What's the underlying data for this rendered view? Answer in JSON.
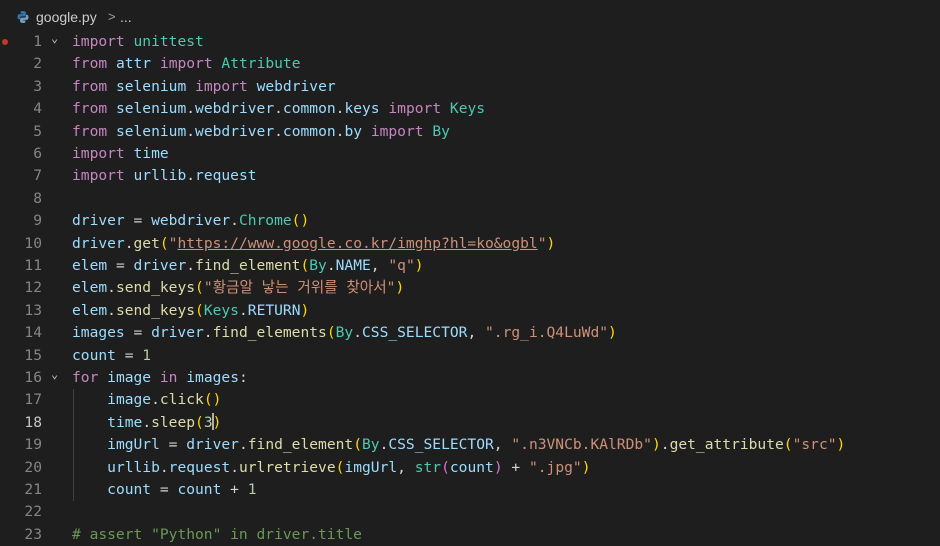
{
  "breadcrumb": {
    "filename": "google.py",
    "separator": ">",
    "ellipsis": "..."
  },
  "editor": {
    "active_line": 18,
    "lines": [
      {
        "n": "1",
        "fold": "v",
        "t": [
          [
            "import",
            "kw"
          ],
          [
            " ",
            ""
          ],
          [
            "unittest",
            "cls"
          ]
        ]
      },
      {
        "n": "2",
        "t": [
          [
            "from",
            "kw"
          ],
          [
            " ",
            ""
          ],
          [
            "attr",
            "v"
          ],
          [
            " ",
            ""
          ],
          [
            "import",
            "kw"
          ],
          [
            " ",
            ""
          ],
          [
            "Attribute",
            "cls"
          ]
        ]
      },
      {
        "n": "3",
        "t": [
          [
            "from",
            "kw"
          ],
          [
            " ",
            ""
          ],
          [
            "selenium",
            "v"
          ],
          [
            " ",
            ""
          ],
          [
            "import",
            "kw"
          ],
          [
            " ",
            ""
          ],
          [
            "webdriver",
            "v"
          ]
        ]
      },
      {
        "n": "4",
        "t": [
          [
            "from",
            "kw"
          ],
          [
            " ",
            ""
          ],
          [
            "selenium",
            "v"
          ],
          [
            ".",
            "p"
          ],
          [
            "webdriver",
            "v"
          ],
          [
            ".",
            "p"
          ],
          [
            "common",
            "v"
          ],
          [
            ".",
            "p"
          ],
          [
            "keys",
            "v"
          ],
          [
            " ",
            ""
          ],
          [
            "import",
            "kw"
          ],
          [
            " ",
            ""
          ],
          [
            "Keys",
            "cls"
          ]
        ]
      },
      {
        "n": "5",
        "t": [
          [
            "from",
            "kw"
          ],
          [
            " ",
            ""
          ],
          [
            "selenium",
            "v"
          ],
          [
            ".",
            "p"
          ],
          [
            "webdriver",
            "v"
          ],
          [
            ".",
            "p"
          ],
          [
            "common",
            "v"
          ],
          [
            ".",
            "p"
          ],
          [
            "by",
            "v"
          ],
          [
            " ",
            ""
          ],
          [
            "import",
            "kw"
          ],
          [
            " ",
            ""
          ],
          [
            "By",
            "cls"
          ]
        ]
      },
      {
        "n": "6",
        "t": [
          [
            "import",
            "kw"
          ],
          [
            " ",
            ""
          ],
          [
            "time",
            "v"
          ]
        ]
      },
      {
        "n": "7",
        "t": [
          [
            "import",
            "kw"
          ],
          [
            " ",
            ""
          ],
          [
            "urllib",
            "v"
          ],
          [
            ".",
            "p"
          ],
          [
            "request",
            "v"
          ]
        ]
      },
      {
        "n": "8",
        "t": []
      },
      {
        "n": "9",
        "t": [
          [
            "driver",
            "v"
          ],
          [
            " = ",
            "p"
          ],
          [
            "webdriver",
            "v"
          ],
          [
            ".",
            "p"
          ],
          [
            "Chrome",
            "cls"
          ],
          [
            "()",
            "b1"
          ]
        ]
      },
      {
        "n": "10",
        "t": [
          [
            "driver",
            "v"
          ],
          [
            ".",
            "p"
          ],
          [
            "get",
            "fn"
          ],
          [
            "(",
            "b1"
          ],
          [
            "\"",
            "s"
          ],
          [
            "https://www.google.co.kr/imghp?hl=ko&ogbl",
            "s u"
          ],
          [
            "\"",
            "s"
          ],
          [
            ")",
            "b1"
          ]
        ]
      },
      {
        "n": "11",
        "t": [
          [
            "elem",
            "v"
          ],
          [
            " = ",
            "p"
          ],
          [
            "driver",
            "v"
          ],
          [
            ".",
            "p"
          ],
          [
            "find_element",
            "fn"
          ],
          [
            "(",
            "b1"
          ],
          [
            "By",
            "cls"
          ],
          [
            ".",
            "p"
          ],
          [
            "NAME",
            "v"
          ],
          [
            ", ",
            "p"
          ],
          [
            "\"q\"",
            "s"
          ],
          [
            ")",
            "b1"
          ]
        ]
      },
      {
        "n": "12",
        "t": [
          [
            "elem",
            "v"
          ],
          [
            ".",
            "p"
          ],
          [
            "send_keys",
            "fn"
          ],
          [
            "(",
            "b1"
          ],
          [
            "\"황금알 낳는 거위를 찾아서\"",
            "s"
          ],
          [
            ")",
            "b1"
          ]
        ]
      },
      {
        "n": "13",
        "t": [
          [
            "elem",
            "v"
          ],
          [
            ".",
            "p"
          ],
          [
            "send_keys",
            "fn"
          ],
          [
            "(",
            "b1"
          ],
          [
            "Keys",
            "cls"
          ],
          [
            ".",
            "p"
          ],
          [
            "RETURN",
            "v"
          ],
          [
            ")",
            "b1"
          ]
        ]
      },
      {
        "n": "14",
        "t": [
          [
            "images",
            "v"
          ],
          [
            " = ",
            "p"
          ],
          [
            "driver",
            "v"
          ],
          [
            ".",
            "p"
          ],
          [
            "find_elements",
            "fn"
          ],
          [
            "(",
            "b1"
          ],
          [
            "By",
            "cls"
          ],
          [
            ".",
            "p"
          ],
          [
            "CSS_SELECTOR",
            "v"
          ],
          [
            ", ",
            "p"
          ],
          [
            "\".rg_i.Q4LuWd\"",
            "s"
          ],
          [
            ")",
            "b1"
          ]
        ]
      },
      {
        "n": "15",
        "t": [
          [
            "count",
            "v"
          ],
          [
            " = ",
            "p"
          ],
          [
            "1",
            "n"
          ]
        ]
      },
      {
        "n": "16",
        "fold": "v",
        "t": [
          [
            "for",
            "kw"
          ],
          [
            " ",
            ""
          ],
          [
            "image",
            "v"
          ],
          [
            " ",
            ""
          ],
          [
            "in",
            "kw"
          ],
          [
            " ",
            ""
          ],
          [
            "images",
            "v"
          ],
          [
            ":",
            "p"
          ]
        ]
      },
      {
        "n": "17",
        "t": [
          [
            "    ",
            ""
          ],
          [
            "image",
            "v"
          ],
          [
            ".",
            "p"
          ],
          [
            "click",
            "fn"
          ],
          [
            "()",
            "b1"
          ]
        ]
      },
      {
        "n": "18",
        "t": [
          [
            "    ",
            ""
          ],
          [
            "time",
            "v"
          ],
          [
            ".",
            "p"
          ],
          [
            "sleep",
            "fn"
          ],
          [
            "(",
            "b1"
          ],
          [
            "3",
            "n"
          ],
          [
            "|",
            "cursor"
          ],
          [
            ")",
            "b1"
          ]
        ]
      },
      {
        "n": "19",
        "t": [
          [
            "    ",
            ""
          ],
          [
            "imgUrl",
            "v"
          ],
          [
            " = ",
            "p"
          ],
          [
            "driver",
            "v"
          ],
          [
            ".",
            "p"
          ],
          [
            "find_element",
            "fn"
          ],
          [
            "(",
            "b1"
          ],
          [
            "By",
            "cls"
          ],
          [
            ".",
            "p"
          ],
          [
            "CSS_SELECTOR",
            "v"
          ],
          [
            ", ",
            "p"
          ],
          [
            "\".n3VNCb.KAlRDb\"",
            "s"
          ],
          [
            ")",
            "b1"
          ],
          [
            ".",
            "p"
          ],
          [
            "get_attribute",
            "fn"
          ],
          [
            "(",
            "b1"
          ],
          [
            "\"src\"",
            "s"
          ],
          [
            ")",
            "b1"
          ]
        ]
      },
      {
        "n": "20",
        "t": [
          [
            "    ",
            ""
          ],
          [
            "urllib",
            "v"
          ],
          [
            ".",
            "p"
          ],
          [
            "request",
            "v"
          ],
          [
            ".",
            "p"
          ],
          [
            "urlretrieve",
            "fn"
          ],
          [
            "(",
            "b1"
          ],
          [
            "imgUrl",
            "v"
          ],
          [
            ", ",
            "p"
          ],
          [
            "str",
            "cls"
          ],
          [
            "(",
            "b2"
          ],
          [
            "count",
            "v"
          ],
          [
            ")",
            "b2"
          ],
          [
            " + ",
            "p"
          ],
          [
            "\".jpg\"",
            "s"
          ],
          [
            ")",
            "b1"
          ]
        ]
      },
      {
        "n": "21",
        "t": [
          [
            "    ",
            ""
          ],
          [
            "count",
            "v"
          ],
          [
            " = ",
            "p"
          ],
          [
            "count",
            "v"
          ],
          [
            " + ",
            "p"
          ],
          [
            "1",
            "n"
          ]
        ]
      },
      {
        "n": "22",
        "t": []
      },
      {
        "n": "23",
        "t": [
          [
            "# assert \"Python\" in driver.title",
            "c"
          ]
        ]
      }
    ]
  },
  "colors": {
    "background": "#1e1e1e",
    "keyword": "#c586c0",
    "variable": "#9cdcfe",
    "class": "#4ec9b0",
    "function": "#dcdcaa",
    "string": "#ce9178",
    "number": "#b5cea8",
    "comment": "#6a9955",
    "breakpoint": "#c0392b"
  }
}
